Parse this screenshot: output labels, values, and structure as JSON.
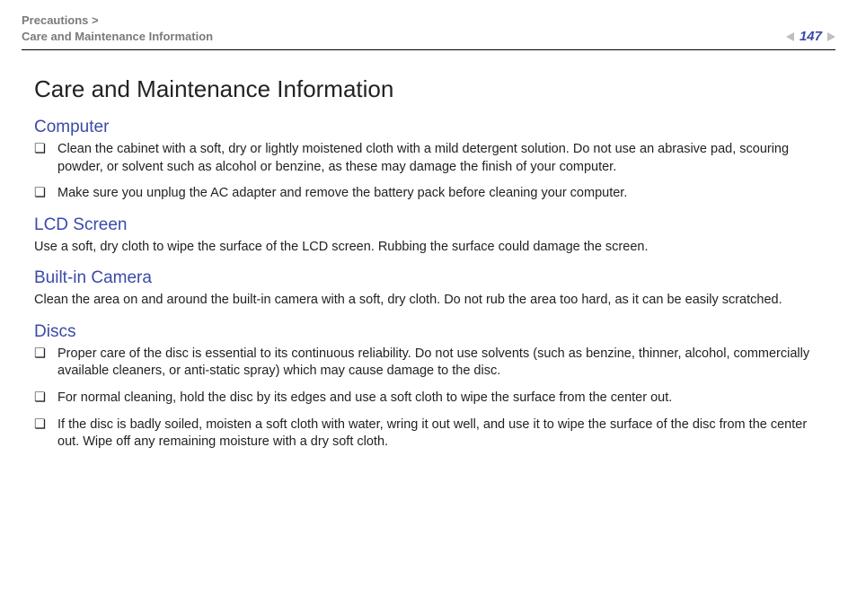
{
  "header": {
    "breadcrumb_top": "Precautions >",
    "breadcrumb_bottom": "Care and Maintenance Information",
    "page_number": "147"
  },
  "title": "Care and Maintenance Information",
  "sections": [
    {
      "heading": "Computer",
      "bullets": [
        "Clean the cabinet with a soft, dry or lightly moistened cloth with a mild detergent solution. Do not use an abrasive pad, scouring powder, or solvent such as alcohol or benzine, as these may damage the finish of your computer.",
        "Make sure you unplug the AC adapter and remove the battery pack before cleaning your computer."
      ]
    },
    {
      "heading": "LCD Screen",
      "body": "Use a soft, dry cloth to wipe the surface of the LCD screen. Rubbing the surface could damage the screen."
    },
    {
      "heading": "Built-in Camera",
      "body": "Clean the area on and around the built-in camera with a soft, dry cloth. Do not rub the area too hard, as it can be easily scratched."
    },
    {
      "heading": "Discs",
      "bullets": [
        "Proper care of the disc is essential to its continuous reliability. Do not use solvents (such as benzine, thinner, alcohol, commercially available cleaners, or anti-static spray) which may cause damage to the disc.",
        "For normal cleaning, hold the disc by its edges and use a soft cloth to wipe the surface from the center out.",
        "If the disc is badly soiled, moisten a soft cloth with water, wring it out well, and use it to wipe the surface of the disc from the center out. Wipe off any remaining moisture with a dry soft cloth."
      ]
    }
  ],
  "bullet_glyph": "❏"
}
